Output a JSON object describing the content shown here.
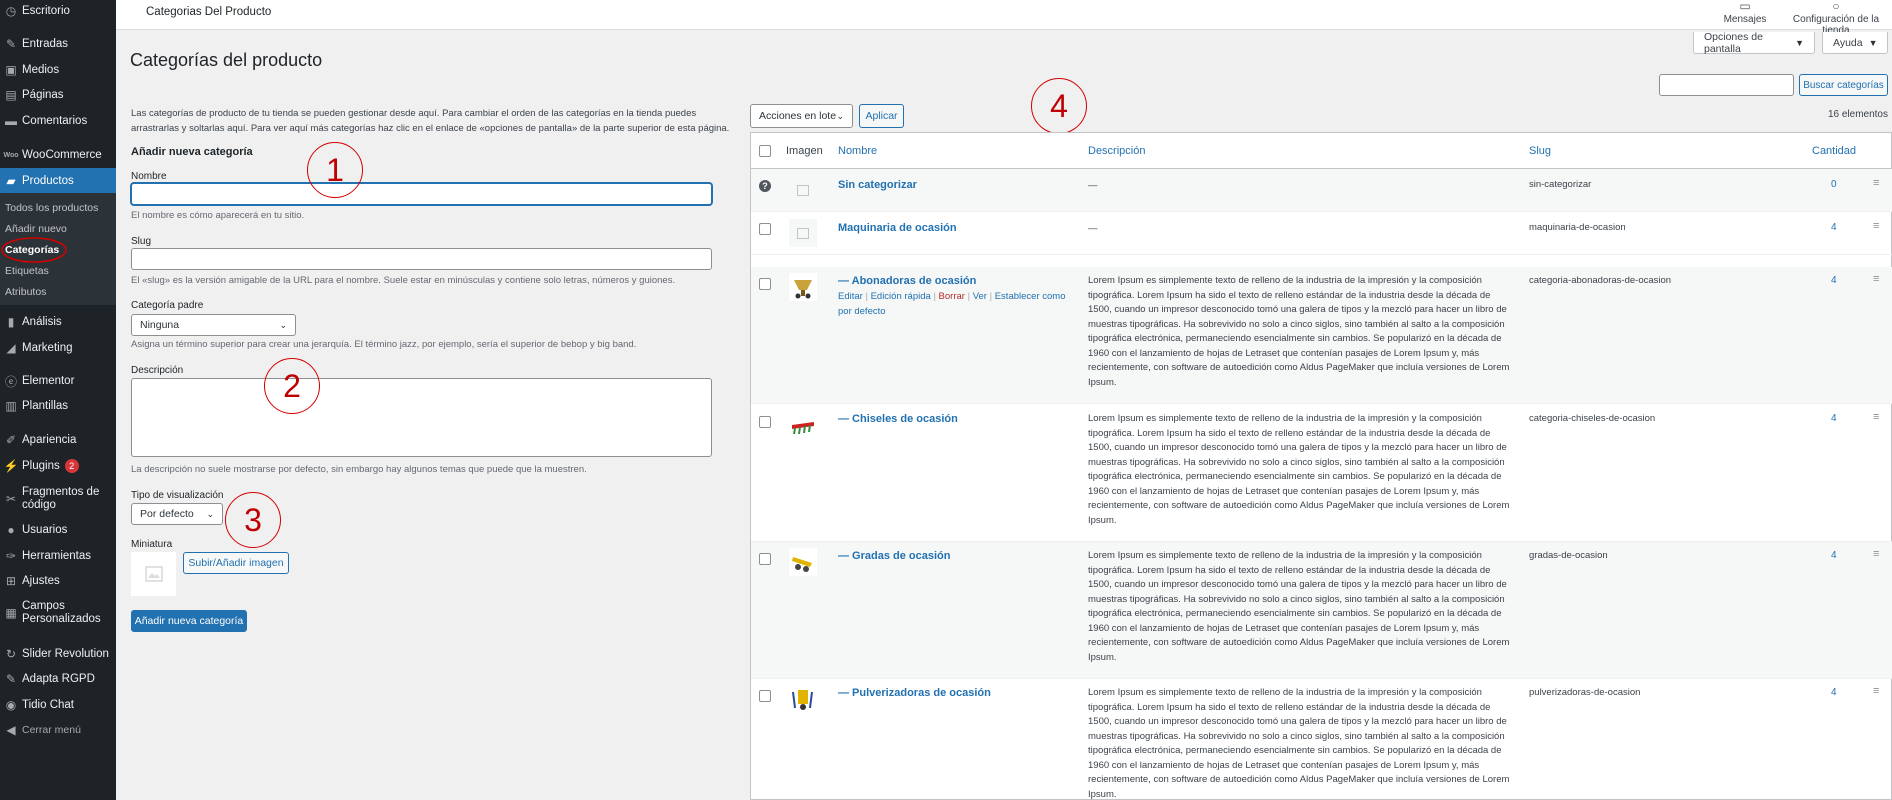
{
  "sidebar": {
    "items": [
      {
        "label": "Escritorio",
        "icon": "dashboard-icon"
      },
      {
        "label": "Entradas",
        "icon": "pin-icon"
      },
      {
        "label": "Medios",
        "icon": "media-icon"
      },
      {
        "label": "Páginas",
        "icon": "pages-icon"
      },
      {
        "label": "Comentarios",
        "icon": "comment-icon"
      },
      {
        "label": "WooCommerce",
        "icon": "woocommerce-icon"
      },
      {
        "label": "Productos",
        "icon": "products-icon"
      },
      {
        "label": "Análisis",
        "icon": "analytics-icon"
      },
      {
        "label": "Marketing",
        "icon": "megaphone-icon"
      },
      {
        "label": "Elementor",
        "icon": "elementor-icon"
      },
      {
        "label": "Plantillas",
        "icon": "templates-icon"
      },
      {
        "label": "Apariencia",
        "icon": "brush-icon"
      },
      {
        "label": "Plugins",
        "icon": "plugin-icon",
        "badge": "2"
      },
      {
        "label": "Fragmentos de código",
        "icon": "scissors-icon"
      },
      {
        "label": "Usuarios",
        "icon": "user-icon"
      },
      {
        "label": "Herramientas",
        "icon": "wrench-icon"
      },
      {
        "label": "Ajustes",
        "icon": "settings-icon"
      },
      {
        "label": "Campos Personalizados",
        "icon": "fields-icon"
      },
      {
        "label": "Slider Revolution",
        "icon": "refresh-icon"
      },
      {
        "label": "Adapta RGPD",
        "icon": "adapta-icon"
      },
      {
        "label": "Tidio Chat",
        "icon": "chat-icon"
      },
      {
        "label": "Cerrar menú",
        "icon": "collapse-icon"
      }
    ],
    "submenu": [
      "Todos los productos",
      "Añadir nuevo",
      "Categorías",
      "Etiquetas",
      "Atributos"
    ]
  },
  "topbar": {
    "title": "Categorias Del Producto",
    "messages": "Mensajes",
    "store_config": "Configuración de la tienda"
  },
  "screen_options": {
    "options": "Opciones de pantalla",
    "help": "Ayuda"
  },
  "page": {
    "title": "Categorías del producto",
    "intro": "Las categorías de producto de tu tienda se pueden gestionar desde aquí. Para cambiar el orden de las categorías en la tienda puedes arrastrarlas y soltarlas aquí. Para ver aquí más categorías haz clic en el enlace de «opciones de pantalla» de la parte superior de esta página."
  },
  "form": {
    "heading": "Añadir nueva categoría",
    "name_label": "Nombre",
    "name_value": "",
    "name_help": "El nombre es cómo aparecerá en tu sitio.",
    "slug_label": "Slug",
    "slug_value": "",
    "slug_help": "El «slug» es la versión amigable de la URL para el nombre. Suele estar en minúsculas y contiene solo letras, números y guiones.",
    "parent_label": "Categoría padre",
    "parent_value": "Ninguna",
    "parent_help": "Asigna un término superior para crear una jerarquía. El término jazz, por ejemplo, sería el superior de bebop y big band.",
    "description_label": "Descripción",
    "description_value": "",
    "description_help": "La descripción no suele mostrarse por defecto, sin embargo hay algunos temas que puede que la muestren.",
    "display_type_label": "Tipo de visualización",
    "display_type_value": "Por defecto",
    "thumbnail_label": "Miniatura",
    "upload_button": "Subir/Añadir imagen",
    "submit_button": "Añadir nueva categoría"
  },
  "annotations": [
    "1",
    "2",
    "3",
    "4"
  ],
  "list": {
    "bulk_actions": "Acciones en lote",
    "apply": "Aplicar",
    "search_value": "",
    "search_button": "Buscar categorías",
    "count": "16 elementos",
    "columns": {
      "image": "Imagen",
      "name": "Nombre",
      "description": "Descripción",
      "slug": "Slug",
      "count": "Cantidad"
    },
    "row_actions": {
      "edit": "Editar",
      "quick_edit": "Edición rápida",
      "delete": "Borrar",
      "view": "Ver",
      "set_default": "Establecer como por defecto",
      "separator": "|"
    },
    "lorem": "Lorem Ipsum es simplemente texto de relleno de la industria de la impresión y la composición tipográfica. Lorem Ipsum ha sido el texto de relleno estándar de la industria desde la década de 1500, cuando un impresor desconocido tomó una galera de tipos y la mezcló para hacer un libro de muestras tipográficas. Ha sobrevivido no solo a cinco siglos, sino también al salto a la composición tipográfica electrónica, permaneciendo esencialmente sin cambios. Se popularizó en la década de 1960 con el lanzamiento de hojas de Letraset que contenían pasajes de Lorem Ipsum y, más recientemente, con software de autoedición como Aldus PageMaker que incluía versiones de Lorem Ipsum.",
    "rows": [
      {
        "name": "Sin categorizar",
        "description": "—",
        "slug": "sin-categorizar",
        "count": "0"
      },
      {
        "name": "Maquinaria de ocasión",
        "description": "—",
        "slug": "maquinaria-de-ocasion",
        "count": "4"
      },
      {
        "name": "— Abonadoras de ocasión",
        "slug": "categoria-abonadoras-de-ocasion",
        "count": "4"
      },
      {
        "name": "— Chiseles de ocasión",
        "slug": "categoria-chiseles-de-ocasion",
        "count": "4"
      },
      {
        "name": "— Gradas de ocasión",
        "slug": "gradas-de-ocasion",
        "count": "4"
      },
      {
        "name": "— Pulverizadoras de ocasión",
        "slug": "pulverizadoras-de-ocasion",
        "count": "4"
      }
    ]
  }
}
